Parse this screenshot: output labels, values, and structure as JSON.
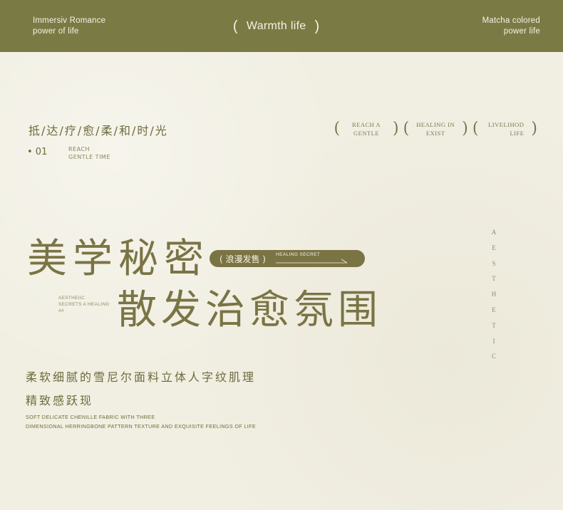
{
  "banner": {
    "left_line1": "Immersiv Romance",
    "left_line2": "power of life",
    "center_open": "(",
    "center_text": "Warmth life",
    "center_close": ")",
    "right_line1": "Matcha colored",
    "right_line2": "power life"
  },
  "section": {
    "cn_title": "抵/达/疗/愈/柔/和/时/光",
    "number": "• 01",
    "sub_line1": "REACH",
    "sub_line2": "GENTLE TIME"
  },
  "tags": [
    {
      "line1": "REACH A",
      "line2": "GENTLE"
    },
    {
      "line1": "HEALING IN",
      "line2": "EXIST"
    },
    {
      "line1": "LIVELIHOD",
      "line2": "LIFE"
    }
  ],
  "hero": {
    "title_line1": "美学秘密",
    "title_line2": "散发治愈氛围",
    "pill_cn": "( 浪漫发售 )",
    "pill_en": "HEALING SECRET",
    "aside_line1": "AESTHEIIC",
    "aside_line2": "SECRETS A HEALING",
    "aside_line3": "##",
    "vertical_letters": [
      "A",
      "E",
      "S",
      "T",
      "H",
      "E",
      "T",
      "I",
      "C"
    ]
  },
  "description": {
    "cn_line1": "柔软细腻的雪尼尔面料立体人字纹肌理",
    "cn_line2": "精致感跃现",
    "en_line1": "SOFT DELICATE CHENILLE FABRIC WITH THREE",
    "en_line2": "DIMENSIONAL HERRINGBONE PATTERN TEXTURE AND EXQUISITE FEELINGS OF LIFE"
  },
  "colors": {
    "banner": "#7a7a45",
    "text_olive": "#6e6b3c",
    "background": "#f1efe2"
  }
}
